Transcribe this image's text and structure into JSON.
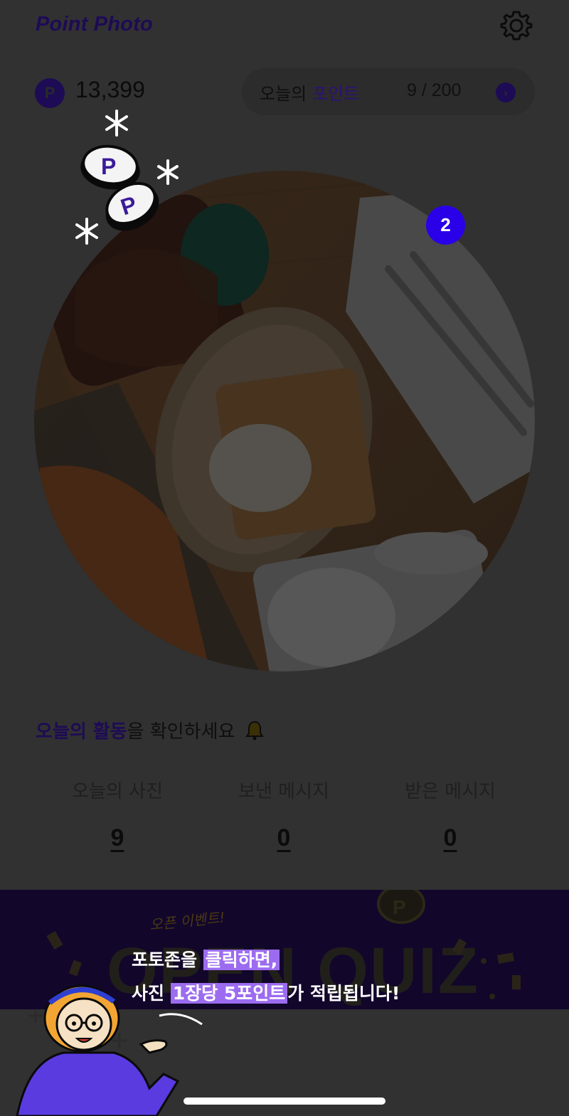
{
  "header": {
    "app_title": "Point Photo",
    "settings_icon": "gear-icon"
  },
  "points": {
    "badge_letter": "P",
    "total": "13,399",
    "today_label_prefix": "오늘의",
    "today_label_highlight": "포인트",
    "today_count": "9 / 200",
    "arrow_icon": "chevron-right-icon"
  },
  "photo": {
    "badge_count": "2"
  },
  "activity": {
    "title_highlight": "오늘의 활동",
    "title_rest": "을 확인하세요",
    "stats": [
      {
        "label": "오늘의 사진",
        "value": "9"
      },
      {
        "label": "보낸 메시지",
        "value": "0"
      },
      {
        "label": "받은 메시지",
        "value": "0"
      }
    ]
  },
  "banner": {
    "small_text": "오픈 이벤트!",
    "big_text": "OPEN QUIZ"
  },
  "tooltip": {
    "line1_pre": "포토존을 ",
    "line1_hl": "클릭하면,",
    "line2_pre": "사진 ",
    "line2_hl": "1장당 5포인트",
    "line2_post": "가 적립됩니다!"
  },
  "colors": {
    "overlay_bg": "#313131",
    "brand_dark": "#1d0b55",
    "badge_blue": "#2a00e8",
    "highlight_purple": "#9c6cf0"
  }
}
